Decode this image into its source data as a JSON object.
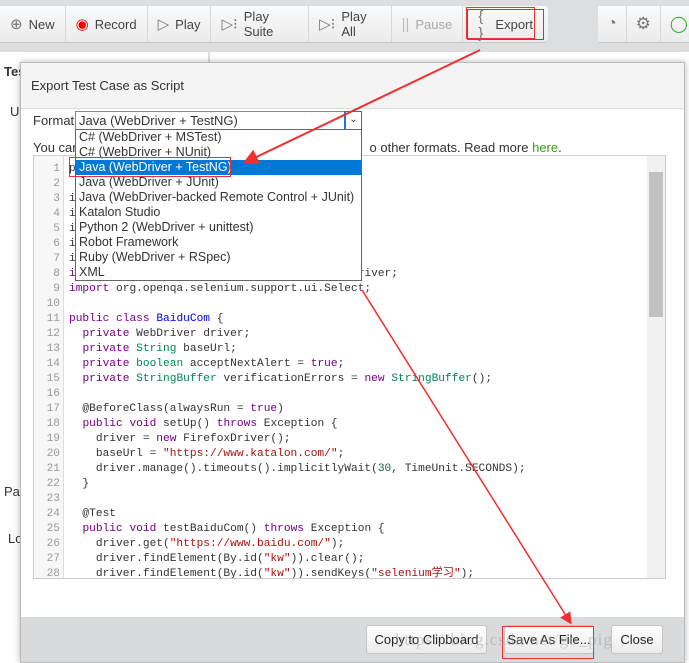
{
  "toolbar": {
    "items": [
      {
        "label": "New",
        "icon": "plus-circle-icon"
      },
      {
        "label": "Record",
        "icon": "record-icon"
      },
      {
        "label": "Play",
        "icon": "play-icon"
      },
      {
        "label": "Play Suite",
        "icon": "play-suite-icon"
      },
      {
        "label": "Play All",
        "icon": "play-all-icon"
      },
      {
        "label": "Pause",
        "icon": "pause-icon",
        "disabled": true
      },
      {
        "label": "Export",
        "icon": "braces-icon"
      }
    ]
  },
  "background": {
    "tab_partial": "Tes",
    "row_partial": "Ur",
    "pass_partial": "Pas",
    "log_partial": "Lo"
  },
  "dialog": {
    "title": "Export Test Case as Script",
    "format_label": "Format",
    "format_value": "Java (WebDriver + TestNG)",
    "info_prefix": "You can",
    "info_suffix": "o other formats. Read more ",
    "info_link": "here",
    "info_end": ".",
    "options": [
      "C# (WebDriver + MSTest)",
      "C# (WebDriver + NUnit)",
      "Java (WebDriver + TestNG)",
      "Java (WebDriver + JUnit)",
      "Java (WebDriver-backed Remote Control + JUnit)",
      "Katalon Studio",
      "Python 2 (WebDriver + unittest)",
      "Robot Framework",
      "Ruby (WebDriver + RSpec)",
      "XML"
    ],
    "selected_index": 2,
    "code_lines": [
      "p",
      "",
      "i",
      "i",
      "i",
      "i",
      "i",
      "import org.openqa.selenium.firefox.FirefoxDriver;",
      "import org.openqa.selenium.support.ui.Select;",
      "",
      "public class BaiduCom {",
      "  private WebDriver driver;",
      "  private String baseUrl;",
      "  private boolean acceptNextAlert = true;",
      "  private StringBuffer verificationErrors = new StringBuffer();",
      "",
      "  @BeforeClass(alwaysRun = true)",
      "  public void setUp() throws Exception {",
      "    driver = new FirefoxDriver();",
      "    baseUrl = \"https://www.katalon.com/\";",
      "    driver.manage().timeouts().implicitlyWait(30, TimeUnit.SECONDS);",
      "  }",
      "",
      "  @Test",
      "  public void testBaiduCom() throws Exception {",
      "    driver.get(\"https://www.baidu.com/\");",
      "    driver.findElement(By.id(\"kw\")).clear();",
      "    driver.findElement(By.id(\"kw\")).sendKeys(\"selenium学习\");"
    ],
    "buttons": {
      "copy": "Copy to Clipboard",
      "save": "Save As File...",
      "close": "Close"
    }
  },
  "watermark": "https://blog.csdn.net/go_pig",
  "colors": {
    "annotation": "#f03030",
    "selected": "#0078d7",
    "link": "#3a9a1a"
  }
}
